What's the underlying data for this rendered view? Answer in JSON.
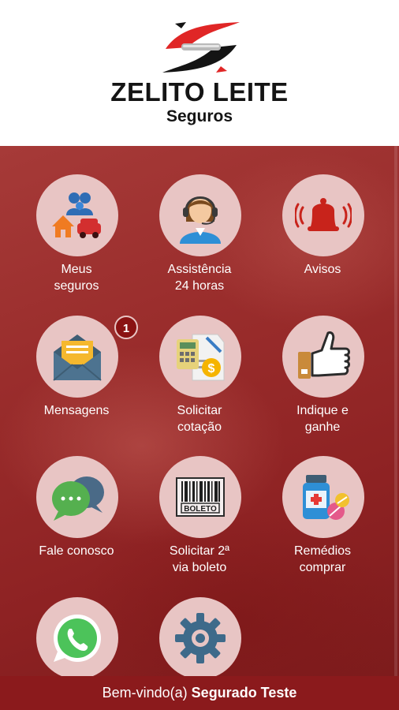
{
  "brand": {
    "name": "ZELITO LEITE",
    "sub": "Seguros"
  },
  "tiles": [
    {
      "line1": "Meus",
      "line2": "seguros"
    },
    {
      "line1": "Assistência",
      "line2": "24 horas"
    },
    {
      "line1": "Avisos",
      "line2": ""
    },
    {
      "line1": "Mensagens",
      "line2": "",
      "badge": "1"
    },
    {
      "line1": "Solicitar",
      "line2": "cotação"
    },
    {
      "line1": "Indique e",
      "line2": "ganhe"
    },
    {
      "line1": "Fale conosco",
      "line2": ""
    },
    {
      "line1": "Solicitar 2ª",
      "line2": "via boleto",
      "icon_text": "BOLETO"
    },
    {
      "line1": "Remédios",
      "line2": "comprar"
    },
    {
      "line1": "",
      "line2": ""
    },
    {
      "line1": "",
      "line2": ""
    }
  ],
  "footer": {
    "greeting": "Bem-vindo(a)",
    "user": "Segurado Teste"
  },
  "colors": {
    "accent": "#8b1a1c",
    "circle": "#e8c5c4"
  }
}
